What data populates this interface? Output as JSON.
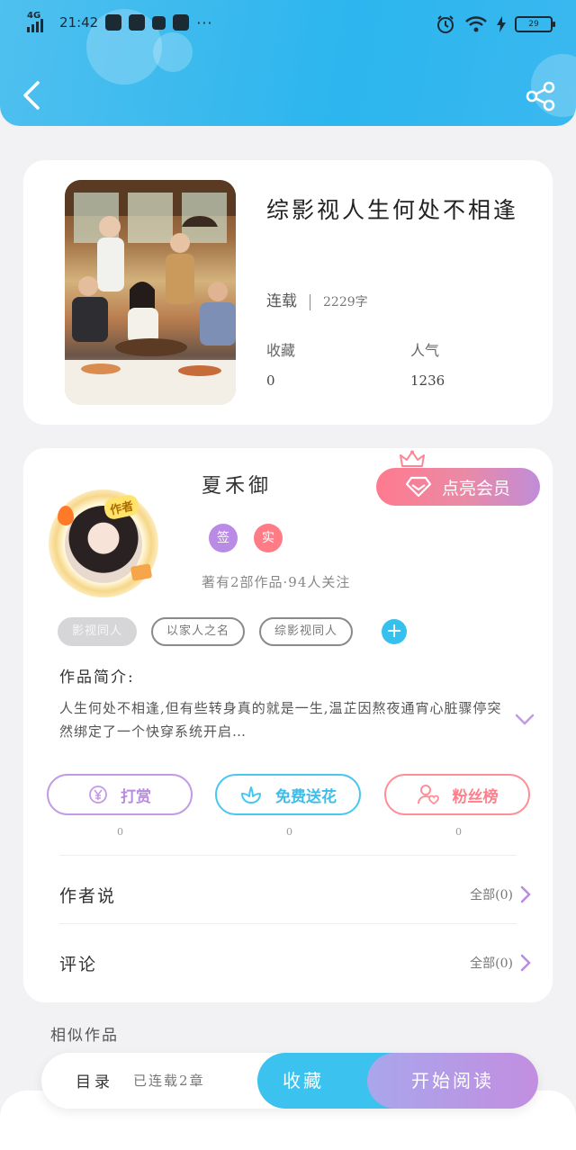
{
  "status_bar": {
    "network": "4G",
    "time": "21:42",
    "more": "···",
    "battery": "29"
  },
  "book": {
    "title": "综影视人生何处不相逢",
    "status": "连载",
    "word_count": "2229字",
    "favorites_label": "收藏",
    "favorites_value": "0",
    "popularity_label": "人气",
    "popularity_value": "1236"
  },
  "author": {
    "name": "夏禾御",
    "avatar_tag": "作者",
    "badge_signed": "签",
    "badge_real": "实",
    "meta": "著有2部作品·94人关注",
    "vip_button": "点亮会员"
  },
  "tags": [
    "影视同人",
    "以家人之名",
    "综影视同人"
  ],
  "intro": {
    "title": "作品简介:",
    "text": "人生何处不相逢,但有些转身真的就是一生,温芷因熬夜通宵心脏骤停突然绑定了一个快穿系统开启…"
  },
  "actions": [
    {
      "label": "打赏",
      "count": "0",
      "icon": "yen-icon",
      "color": "#b98be0"
    },
    {
      "label": "免费送花",
      "count": "0",
      "icon": "flower-icon",
      "color": "#3fbde8"
    },
    {
      "label": "粉丝榜",
      "count": "0",
      "icon": "fan-ranking-icon",
      "color": "#ff7f8a"
    }
  ],
  "author_says": {
    "title": "作者说",
    "more": "全部(0)"
  },
  "comments": {
    "title": "评论",
    "more": "全部(0)"
  },
  "similar": {
    "title": "相似作品"
  },
  "bottom_bar": {
    "toc": "目录",
    "toc_meta": "已连载2章",
    "collect": "收藏",
    "read": "开始阅读"
  },
  "colors": {
    "header": "#2cb5ee",
    "accent_blue": "#3cc2ee",
    "accent_purple": "#c28ee0",
    "accent_pink": "#ff7a8e"
  }
}
